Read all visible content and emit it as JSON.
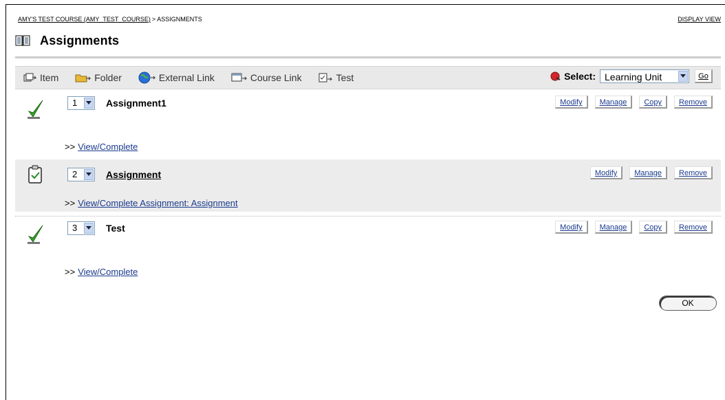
{
  "breadcrumb": {
    "course": "AMY'S TEST COURSE (AMY_TEST_COURSE)",
    "separator": ">",
    "current": "ASSIGNMENTS"
  },
  "display_view_label": "DISPLAY VIEW",
  "page": {
    "title": "Assignments"
  },
  "toolbar": {
    "items": [
      {
        "label": "Item",
        "icon": "item-icon"
      },
      {
        "label": "Folder",
        "icon": "folder-icon"
      },
      {
        "label": "External Link",
        "icon": "globe-icon"
      },
      {
        "label": "Course Link",
        "icon": "course-link-icon"
      },
      {
        "label": "Test",
        "icon": "test-icon"
      }
    ],
    "select_label": "Select:",
    "select_value": "Learning Unit",
    "go_label": "Go"
  },
  "rows": [
    {
      "number": "1",
      "name": "Assignment1",
      "link_prefix": ">>",
      "link_text": "View/Complete",
      "icon": "check-mark-icon",
      "actions": [
        "Modify",
        "Manage",
        "Copy",
        "Remove"
      ]
    },
    {
      "number": "2",
      "name": "Assignment",
      "link_prefix": ">>",
      "link_text": "View/Complete Assignment: Assignment",
      "icon": "clipboard-check-icon",
      "actions": [
        "Modify",
        "Manage",
        "Remove"
      ]
    },
    {
      "number": "3",
      "name": "Test",
      "link_prefix": ">>",
      "link_text": "View/Complete",
      "icon": "check-mark-icon",
      "actions": [
        "Modify",
        "Manage",
        "Copy",
        "Remove"
      ]
    }
  ],
  "ok_label": "OK"
}
